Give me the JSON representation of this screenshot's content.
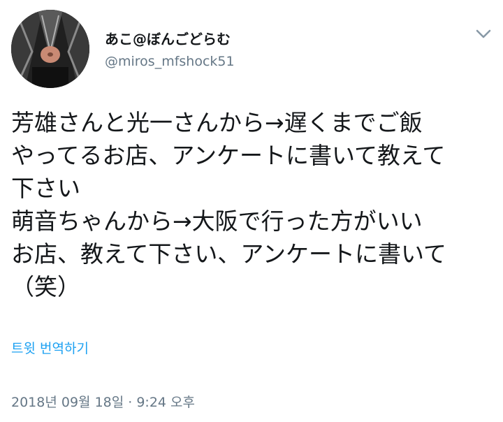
{
  "user": {
    "display_name": "あこ@ぼんごどらむ",
    "handle": "@miros_mfshock51",
    "avatar_icon": "profile-photo"
  },
  "tweet": {
    "lines": [
      "芳雄さんと光一さんから→遅くまでご飯",
      "やってるお店、アンケートに書いて教えて",
      "下さい",
      "萌音ちゃんから→大阪で行った方がいい",
      "お店、教えて下さい、アンケートに書いて",
      "（笑）"
    ]
  },
  "translate_link": "트윗 번역하기",
  "timestamp": "2018년 09월 18일 · 9:24 오후",
  "menu_icon": "chevron-down-icon",
  "colors": {
    "link": "#1da1f2",
    "secondary_text": "#657786",
    "primary_text": "#14171a"
  }
}
